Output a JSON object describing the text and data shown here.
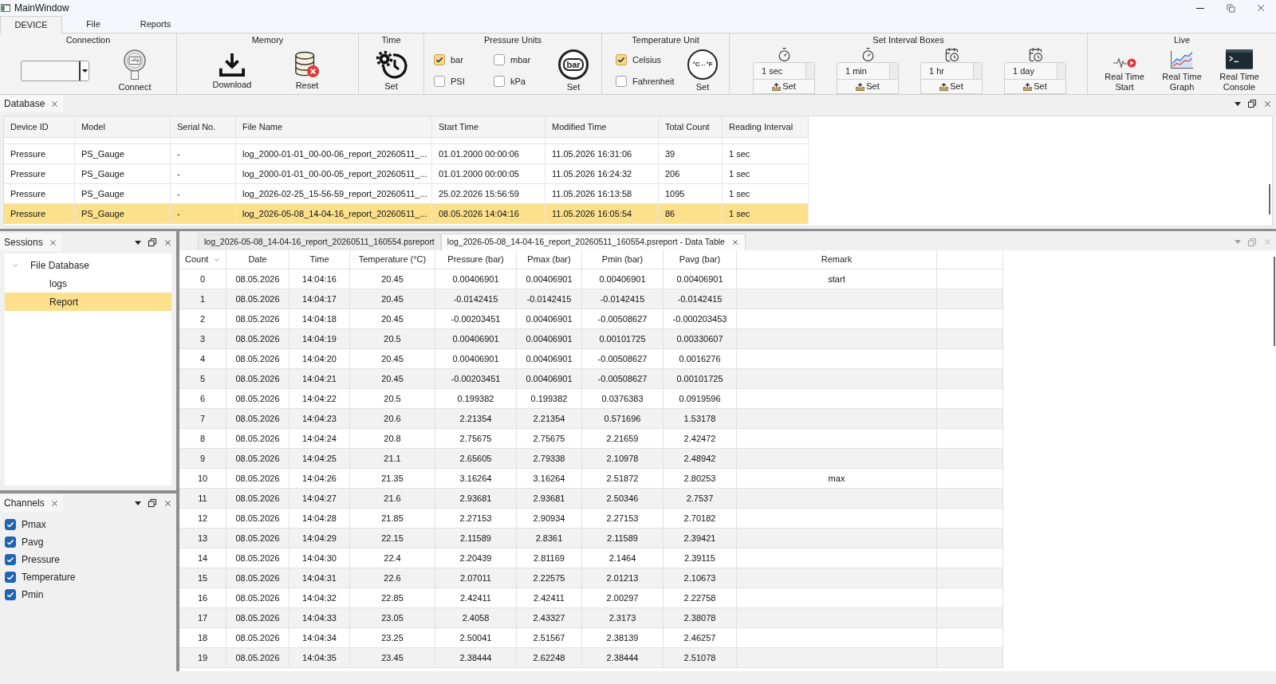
{
  "window": {
    "title": "MainWindow"
  },
  "ribbon_tabs": [
    {
      "label": "DEVICE",
      "selected": true
    },
    {
      "label": "File",
      "selected": false
    },
    {
      "label": "Reports",
      "selected": false
    }
  ],
  "ribbon": {
    "connection": {
      "title": "Connection",
      "connect_button": "Connect"
    },
    "memory": {
      "title": "Memory",
      "download_button": "Download",
      "reset_button": "Reset"
    },
    "time": {
      "title": "Time",
      "set_button": "Set"
    },
    "pressure_units": {
      "title": "Pressure Units",
      "options": [
        {
          "label": "bar",
          "checked": true
        },
        {
          "label": "mbar",
          "checked": false
        },
        {
          "label": "PSI",
          "checked": false
        },
        {
          "label": "kPa",
          "checked": false
        }
      ],
      "dial_label": "bar",
      "set_button": "Set"
    },
    "temperature_unit": {
      "title": "Temperature Unit",
      "options": [
        {
          "label": "Celsius",
          "checked": true
        },
        {
          "label": "Fahrenheit",
          "checked": false
        }
      ],
      "dial_label": "°C↔°F",
      "set_button": "Set"
    },
    "interval_boxes": {
      "title": "Set Interval Boxes",
      "boxes": [
        {
          "value": "1 sec",
          "set_button": "Set"
        },
        {
          "value": "1 min",
          "set_button": "Set"
        },
        {
          "value": "1 hr",
          "set_button": "Set"
        },
        {
          "value": "1 day",
          "set_button": "Set"
        }
      ]
    },
    "live": {
      "title": "Live",
      "buttons": [
        "Real Time Start",
        "Real Time Graph",
        "Real Time Console"
      ]
    }
  },
  "database_dock": {
    "title": "Database",
    "table": {
      "columns": [
        "Device ID",
        "Model",
        "Serial No.",
        "File Name",
        "Start Time",
        "Modified Time",
        "Total Count",
        "Reading Interval"
      ],
      "rows": [
        {
          "cells": [
            "Pressure",
            "PS_Gauge",
            "-",
            "log_2000-01-01_00-00-06_report_20260511_...",
            "01.01.2000 00:00:06",
            "11.05.2026 16:31:06",
            "39",
            "1 sec"
          ],
          "selected": false
        },
        {
          "cells": [
            "Pressure",
            "PS_Gauge",
            "-",
            "log_2000-01-01_00-00-05_report_20260511_...",
            "01.01.2000 00:00:05",
            "11.05.2026 16:24:32",
            "206",
            "1 sec"
          ],
          "selected": false
        },
        {
          "cells": [
            "Pressure",
            "PS_Gauge",
            "-",
            "log_2026-02-25_15-56-59_report_20260511_...",
            "25.02.2026 15:56:59",
            "11.05.2026 16:13:58",
            "1095",
            "1 sec"
          ],
          "selected": false
        },
        {
          "cells": [
            "Pressure",
            "PS_Gauge",
            "-",
            "log_2026-05-08_14-04-16_report_20260511_...",
            "08.05.2026 14:04:16",
            "11.05.2026 16:05:54",
            "86",
            "1 sec"
          ],
          "selected": true
        }
      ]
    }
  },
  "sessions_dock": {
    "title": "Sessions",
    "tree": [
      {
        "label": "File Database",
        "expanded": true,
        "selected": false,
        "children": [
          {
            "label": "logs",
            "selected": false
          },
          {
            "label": "Report",
            "selected": true
          }
        ]
      }
    ]
  },
  "channels_dock": {
    "title": "Channels",
    "channels": [
      {
        "label": "Pmax",
        "checked": true
      },
      {
        "label": "Pavg",
        "checked": true
      },
      {
        "label": "Pressure",
        "checked": true
      },
      {
        "label": "Temperature",
        "checked": true
      },
      {
        "label": "Pmin",
        "checked": true
      }
    ]
  },
  "document_tabs": [
    {
      "label": "log_2026-05-08_14-04-16_report_20260511_160554.psreport",
      "selected": false,
      "closable": false
    },
    {
      "label": "log_2026-05-08_14-04-16_report_20260511_160554.psreport - Data Table",
      "selected": true,
      "closable": true
    }
  ],
  "data_table": {
    "columns": [
      {
        "label": "Count",
        "sorted": true
      },
      {
        "label": "Date",
        "sorted": false
      },
      {
        "label": "Time",
        "sorted": false
      },
      {
        "label": "Temperature (°C)",
        "sorted": false
      },
      {
        "label": "Pressure (bar)",
        "sorted": false
      },
      {
        "label": "Pmax (bar)",
        "sorted": false
      },
      {
        "label": "Pmin (bar)",
        "sorted": false
      },
      {
        "label": "Pavg (bar)",
        "sorted": false
      },
      {
        "label": "Remark",
        "sorted": false
      }
    ],
    "rows": [
      [
        "0",
        "08.05.2026",
        "14:04:16",
        "20.45",
        "0.00406901",
        "0.00406901",
        "0.00406901",
        "0.00406901",
        "start"
      ],
      [
        "1",
        "08.05.2026",
        "14:04:17",
        "20.45",
        "-0.0142415",
        "-0.0142415",
        "-0.0142415",
        "-0.0142415"
      ],
      [
        "2",
        "08.05.2026",
        "14:04:18",
        "20.45",
        "-0.00203451",
        "0.00406901",
        "-0.00508627",
        "-0.000203453"
      ],
      [
        "3",
        "08.05.2026",
        "14:04:19",
        "20.5",
        "0.00406901",
        "0.00406901",
        "0.00101725",
        "0.00330607"
      ],
      [
        "4",
        "08.05.2026",
        "14:04:20",
        "20.45",
        "0.00406901",
        "0.00406901",
        "-0.00508627",
        "0.0016276"
      ],
      [
        "5",
        "08.05.2026",
        "14:04:21",
        "20.45",
        "-0.00203451",
        "0.00406901",
        "-0.00508627",
        "0.00101725"
      ],
      [
        "6",
        "08.05.2026",
        "14:04:22",
        "20.5",
        "0.199382",
        "0.199382",
        "0.0376383",
        "0.0919596"
      ],
      [
        "7",
        "08.05.2026",
        "14:04:23",
        "20.6",
        "2.21354",
        "2.21354",
        "0.571696",
        "1.53178"
      ],
      [
        "8",
        "08.05.2026",
        "14:04:24",
        "20.8",
        "2.75675",
        "2.75675",
        "2.21659",
        "2.42472"
      ],
      [
        "9",
        "08.05.2026",
        "14:04:25",
        "21.1",
        "2.65605",
        "2.79338",
        "2.10978",
        "2.48942"
      ],
      [
        "10",
        "08.05.2026",
        "14:04:26",
        "21.35",
        "3.16264",
        "3.16264",
        "2.51872",
        "2.80253",
        "max"
      ],
      [
        "11",
        "08.05.2026",
        "14:04:27",
        "21.6",
        "2.93681",
        "2.93681",
        "2.50346",
        "2.7537"
      ],
      [
        "12",
        "08.05.2026",
        "14:04:28",
        "21.85",
        "2.27153",
        "2.90934",
        "2.27153",
        "2.70182"
      ],
      [
        "13",
        "08.05.2026",
        "14:04:29",
        "22.15",
        "2.11589",
        "2.8361",
        "2.11589",
        "2.39421"
      ],
      [
        "14",
        "08.05.2026",
        "14:04:30",
        "22.4",
        "2.20439",
        "2.81169",
        "2.1464",
        "2.39115"
      ],
      [
        "15",
        "08.05.2026",
        "14:04:31",
        "22.6",
        "2.07011",
        "2.22575",
        "2.01213",
        "2.10673"
      ],
      [
        "16",
        "08.05.2026",
        "14:04:32",
        "22.85",
        "2.42411",
        "2.42411",
        "2.00297",
        "2.22758"
      ],
      [
        "17",
        "08.05.2026",
        "14:04:33",
        "23.05",
        "2.4058",
        "2.43327",
        "2.3173",
        "2.38078"
      ],
      [
        "18",
        "08.05.2026",
        "14:04:34",
        "23.25",
        "2.50041",
        "2.51567",
        "2.38139",
        "2.46257"
      ],
      [
        "19",
        "08.05.2026",
        "14:04:35",
        "23.45",
        "2.38444",
        "2.62248",
        "2.38444",
        "2.51078"
      ]
    ]
  }
}
